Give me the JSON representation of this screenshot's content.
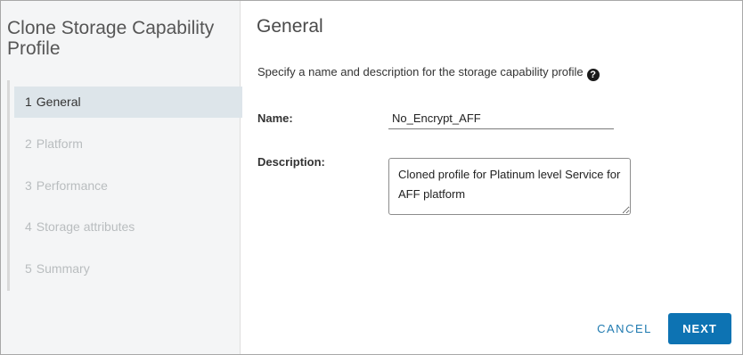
{
  "dialog": {
    "title": "Clone Storage Capability Profile"
  },
  "wizard": {
    "steps": [
      {
        "num": "1",
        "label": "General",
        "active": true
      },
      {
        "num": "2",
        "label": "Platform",
        "active": false
      },
      {
        "num": "3",
        "label": "Performance",
        "active": false
      },
      {
        "num": "4",
        "label": "Storage attributes",
        "active": false
      },
      {
        "num": "5",
        "label": "Summary",
        "active": false
      }
    ]
  },
  "main": {
    "title": "General",
    "intro": "Specify a name and description for the storage capability profile",
    "help_icon": "question-circle-icon",
    "name_label": "Name:",
    "name_value": "No_Encrypt_AFF",
    "description_label": "Description:",
    "description_value": "Cloned profile for Platinum level Service for AFF platform"
  },
  "footer": {
    "cancel_label": "CANCEL",
    "next_label": "NEXT"
  },
  "colors": {
    "accent": "#0d73b3",
    "active_step_bg": "#dde5ea",
    "sidebar_bg": "#f4f5f6"
  }
}
